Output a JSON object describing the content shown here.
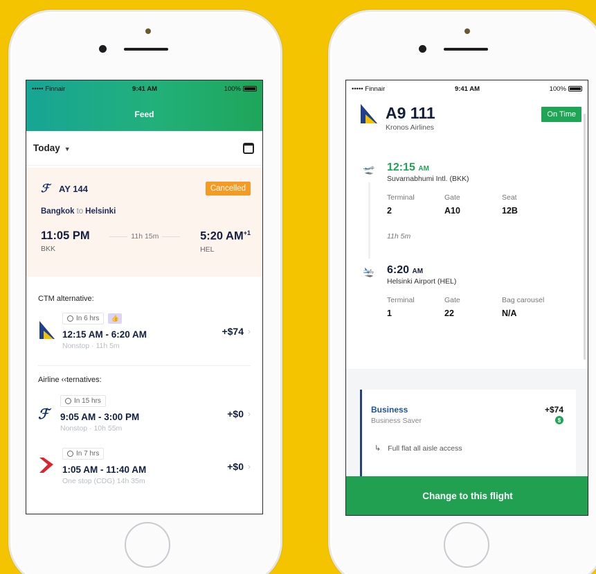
{
  "colors": {
    "background": "#f5c400",
    "feed_gradient_start": "#17a596",
    "feed_gradient_end": "#1ea659",
    "cancelled": "#f59b23",
    "on_time": "#1ea656",
    "cta": "#21a052",
    "fare_accent": "#1d52a6"
  },
  "left": {
    "status": {
      "carrier": "••••• Finnair",
      "time": "9:41 AM",
      "battery": "100%"
    },
    "header": {
      "title": "Feed"
    },
    "date_filter": {
      "label": "Today",
      "icon": "calendar-icon"
    },
    "flight": {
      "code": "AY 144",
      "status": "Cancelled",
      "origin_city": "Bangkok",
      "to_word": "to",
      "dest_city": "Helsinki",
      "dep_time": "11:05 PM",
      "dep_airport": "BKK",
      "duration": "11h 15m",
      "arr_time": "5:20 AM",
      "arr_offset": "+1",
      "arr_airport": "HEL"
    },
    "ctm_heading": "CTM alternative:",
    "ctm_alternative": {
      "badge": "In 6 hrs",
      "times": "12:15 AM - 6:20 AM",
      "sub": "Nonstop · 11h 5m",
      "price": "+$74"
    },
    "airline_heading": "Airline ‹‹ternatives:",
    "airline_alternatives": [
      {
        "badge": "In 15 hrs",
        "times": "9:05 AM - 3:00 PM",
        "sub": "Nonstop · 10h 55m",
        "price": "+$0",
        "logo": "finnair-logo"
      },
      {
        "badge": "In 7 hrs",
        "times": "1:05 AM - 11:40 AM",
        "sub": "One stop (CDG) 14h 35m",
        "price": "+$0",
        "logo": "red-airline-logo"
      }
    ]
  },
  "right": {
    "status": {
      "carrier": "••••• Finnair",
      "time": "9:41 AM",
      "battery": "100%"
    },
    "flight_number": "A9 111",
    "airline": "Kronos Airlines",
    "status_badge": "On Time",
    "departure": {
      "time": "12:15",
      "ampm": "AM",
      "airport": "Suvarnabhumi Intl. (BKK)",
      "labels": [
        "Terminal",
        "Gate",
        "Seat"
      ],
      "values": [
        "2",
        "A10",
        "12B"
      ]
    },
    "duration": "11h 5m",
    "arrival": {
      "time": "6:20",
      "ampm": "AM",
      "airport": "Helsinki Airport (HEL)",
      "labels": [
        "Terminal",
        "Gate",
        "Bag carousel"
      ],
      "values": [
        "1",
        "22",
        "N/A"
      ]
    },
    "fare": {
      "class": "Business",
      "sub": "Business Saver",
      "price": "+$74",
      "icon_text": "$",
      "feature": "Full flat all aisle access"
    },
    "cta": "Change to this flight"
  }
}
